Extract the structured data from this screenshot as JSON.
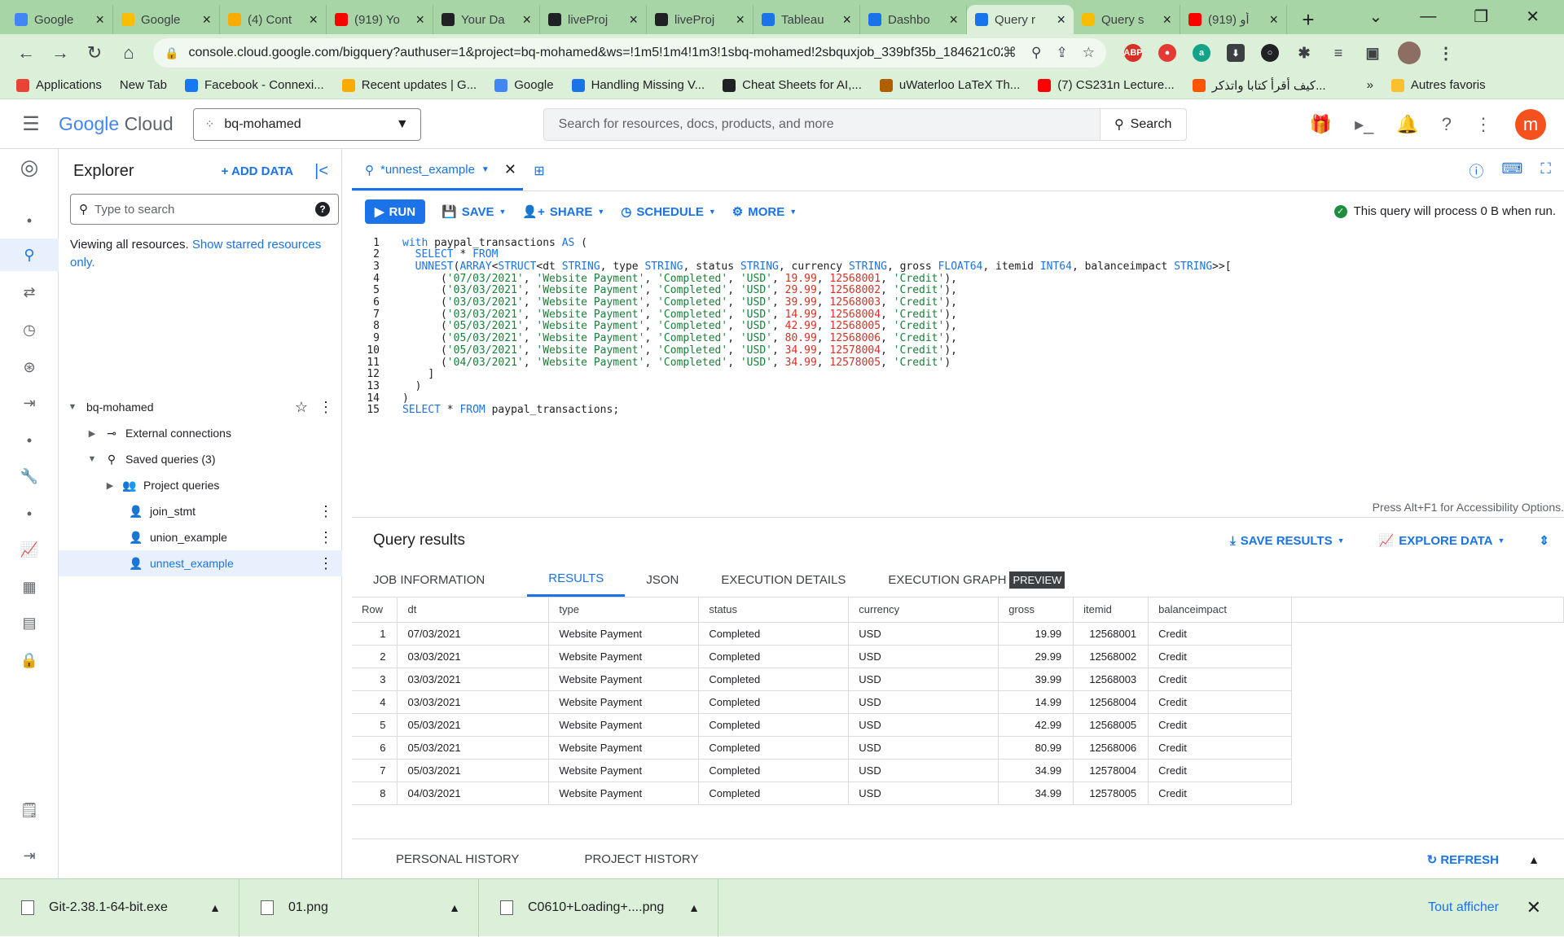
{
  "browser": {
    "tabs": [
      {
        "title": "Google",
        "color": "#4285f4"
      },
      {
        "title": "Google",
        "color": "#fbbc04"
      },
      {
        "title": "(4) Cont",
        "color": "#f9ab00"
      },
      {
        "title": "(919) Yo",
        "color": "#ff0000"
      },
      {
        "title": "Your Da",
        "color": "#202124"
      },
      {
        "title": "liveProj",
        "color": "#202124"
      },
      {
        "title": "liveProj",
        "color": "#202124"
      },
      {
        "title": "Tableau",
        "color": "#1a73e8"
      },
      {
        "title": "Dashbo",
        "color": "#1a73e8"
      },
      {
        "title": "Query r",
        "color": "#1a73e8",
        "active": true
      },
      {
        "title": "Query s",
        "color": "#fbbc04"
      },
      {
        "title": "(919) أو",
        "color": "#ff0000"
      }
    ],
    "url": "console.cloud.google.com/bigquery?authuser=1&project=bq-mohamed&ws=!1m5!1m4!1m3!1sbq-mohamed!2sbquxjob_339bf35b_184621c02...",
    "bookmarks": [
      {
        "label": "Applications",
        "color": "#ea4335"
      },
      {
        "label": "New Tab",
        "color": ""
      },
      {
        "label": "Facebook - Connexi...",
        "color": "#1877f2"
      },
      {
        "label": "Recent updates | G...",
        "color": "#f9ab00"
      },
      {
        "label": "Google",
        "color": "#4285f4"
      },
      {
        "label": "Handling Missing V...",
        "color": "#1a73e8"
      },
      {
        "label": "Cheat Sheets for AI,...",
        "color": "#202124"
      },
      {
        "label": "uWaterloo LaTeX Th...",
        "color": "#b06000"
      },
      {
        "label": "(7) CS231n Lecture...",
        "color": "#ff0000"
      },
      {
        "label": "كيف أقرأ كتابا واتذكر...",
        "color": "#ff5500"
      }
    ],
    "bookmarks_more": "»",
    "other_bookmarks": "Autres favoris"
  },
  "gcp": {
    "logo_google": "Google",
    "logo_cloud": "Cloud",
    "project": "bq-mohamed",
    "search_placeholder": "Search for resources, docs, products, and more",
    "search_button": "Search",
    "avatar_letter": "m"
  },
  "explorer": {
    "title": "Explorer",
    "add_data": "ADD DATA",
    "search_placeholder": "Type to search",
    "viewing_text": "Viewing all resources.",
    "starred_link": "Show starred resources only.",
    "tree": {
      "project": "bq-mohamed",
      "external": "External connections",
      "saved": "Saved queries (3)",
      "project_queries": "Project queries",
      "q1": "join_stmt",
      "q2": "union_example",
      "q3": "unnest_example"
    }
  },
  "editor": {
    "tab_title": "*unnest_example",
    "toolbar": {
      "run": "RUN",
      "save": "SAVE",
      "share": "SHARE",
      "schedule": "SCHEDULE",
      "more": "MORE"
    },
    "process_info": "This query will process 0 B when run.",
    "accessibility_hint": "Press Alt+F1 for Accessibility Options."
  },
  "code_lines": [
    "with paypal_transactions AS (",
    "  SELECT * FROM",
    "  UNNEST(ARRAY<STRUCT<dt STRING, type STRING, status STRING, currency STRING, gross FLOAT64, itemid INT64, balanceimpact STRING>>[",
    "      ('07/03/2021', 'Website Payment', 'Completed', 'USD', 19.99, 12568001, 'Credit'),",
    "      ('03/03/2021', 'Website Payment', 'Completed', 'USD', 29.99, 12568002, 'Credit'),",
    "      ('03/03/2021', 'Website Payment', 'Completed', 'USD', 39.99, 12568003, 'Credit'),",
    "      ('03/03/2021', 'Website Payment', 'Completed', 'USD', 14.99, 12568004, 'Credit'),",
    "      ('05/03/2021', 'Website Payment', 'Completed', 'USD', 42.99, 12568005, 'Credit'),",
    "      ('05/03/2021', 'Website Payment', 'Completed', 'USD', 80.99, 12568006, 'Credit'),",
    "      ('05/03/2021', 'Website Payment', 'Completed', 'USD', 34.99, 12578004, 'Credit'),",
    "      ('04/03/2021', 'Website Payment', 'Completed', 'USD', 34.99, 12578005, 'Credit')",
    "    ]",
    "  )",
    ")",
    "SELECT * FROM paypal_transactions;"
  ],
  "results": {
    "title": "Query results",
    "save_results": "SAVE RESULTS",
    "explore_data": "EXPLORE DATA",
    "tabs": [
      "JOB INFORMATION",
      "RESULTS",
      "JSON",
      "EXECUTION DETAILS",
      "EXECUTION GRAPH"
    ],
    "preview_badge": "PREVIEW",
    "columns": [
      "Row",
      "dt",
      "type",
      "status",
      "currency",
      "gross",
      "itemid",
      "balanceimpact"
    ],
    "rows": [
      [
        "1",
        "07/03/2021",
        "Website Payment",
        "Completed",
        "USD",
        "19.99",
        "12568001",
        "Credit"
      ],
      [
        "2",
        "03/03/2021",
        "Website Payment",
        "Completed",
        "USD",
        "29.99",
        "12568002",
        "Credit"
      ],
      [
        "3",
        "03/03/2021",
        "Website Payment",
        "Completed",
        "USD",
        "39.99",
        "12568003",
        "Credit"
      ],
      [
        "4",
        "03/03/2021",
        "Website Payment",
        "Completed",
        "USD",
        "14.99",
        "12568004",
        "Credit"
      ],
      [
        "5",
        "05/03/2021",
        "Website Payment",
        "Completed",
        "USD",
        "42.99",
        "12568005",
        "Credit"
      ],
      [
        "6",
        "05/03/2021",
        "Website Payment",
        "Completed",
        "USD",
        "80.99",
        "12568006",
        "Credit"
      ],
      [
        "7",
        "05/03/2021",
        "Website Payment",
        "Completed",
        "USD",
        "34.99",
        "12578004",
        "Credit"
      ],
      [
        "8",
        "04/03/2021",
        "Website Payment",
        "Completed",
        "USD",
        "34.99",
        "12578005",
        "Credit"
      ]
    ],
    "personal_history": "PERSONAL HISTORY",
    "project_history": "PROJECT HISTORY",
    "refresh": "REFRESH"
  },
  "downloads": {
    "items": [
      "Git-2.38.1-64-bit.exe",
      "01.png",
      "C0610+Loading+....png"
    ],
    "show_all": "Tout afficher"
  },
  "colors": {
    "accent": "#1a73e8",
    "chrome_frame": "#a8d5a6",
    "avatar": "#f4511e"
  }
}
